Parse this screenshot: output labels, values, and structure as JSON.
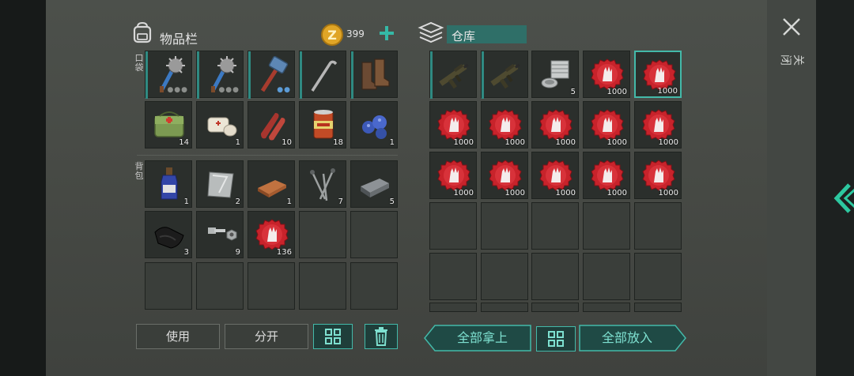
{
  "inventory": {
    "title": "物品栏",
    "coins": "399",
    "pocket_label": "口袋",
    "backpack_label": "背包",
    "pocket_items": [
      {
        "name": "spiked-club",
        "qty": ""
      },
      {
        "name": "spiked-club",
        "qty": ""
      },
      {
        "name": "sledgehammer",
        "qty": ""
      },
      {
        "name": "crowbar",
        "qty": ""
      },
      {
        "name": "boots",
        "qty": ""
      },
      {
        "name": "first-aid-bag",
        "qty": "14"
      },
      {
        "name": "bandage",
        "qty": "1"
      },
      {
        "name": "raw-meat",
        "qty": "10"
      },
      {
        "name": "canned-food",
        "qty": "18"
      },
      {
        "name": "blueberries",
        "qty": "1"
      }
    ],
    "backpack_items": [
      {
        "name": "bottle",
        "qty": "1"
      },
      {
        "name": "metal-sheet",
        "qty": "2"
      },
      {
        "name": "copper-ingot",
        "qty": "1"
      },
      {
        "name": "nails",
        "qty": "7"
      },
      {
        "name": "iron-ingot",
        "qty": "5"
      },
      {
        "name": "black-cloth",
        "qty": "3"
      },
      {
        "name": "bolt-nut",
        "qty": "9"
      },
      {
        "name": "bottle-cap",
        "qty": "136"
      }
    ],
    "use_label": "使用",
    "split_label": "分开"
  },
  "storage": {
    "title": "仓库",
    "items": [
      {
        "name": "assault-rifle",
        "qty": ""
      },
      {
        "name": "assault-rifle",
        "qty": ""
      },
      {
        "name": "engine-parts",
        "qty": "5"
      },
      {
        "name": "bottle-cap",
        "qty": "1000"
      },
      {
        "name": "bottle-cap",
        "qty": "1000"
      },
      {
        "name": "bottle-cap",
        "qty": "1000"
      },
      {
        "name": "bottle-cap",
        "qty": "1000"
      },
      {
        "name": "bottle-cap",
        "qty": "1000"
      },
      {
        "name": "bottle-cap",
        "qty": "1000"
      },
      {
        "name": "bottle-cap",
        "qty": "1000"
      },
      {
        "name": "bottle-cap",
        "qty": "1000"
      },
      {
        "name": "bottle-cap",
        "qty": "1000"
      },
      {
        "name": "bottle-cap",
        "qty": "1000"
      },
      {
        "name": "bottle-cap",
        "qty": "1000"
      },
      {
        "name": "bottle-cap",
        "qty": "1000"
      }
    ],
    "take_all_label": "全部拿上",
    "put_all_label": "全部放入"
  },
  "close_label": "关闭",
  "colors": {
    "accent": "#43b9a9",
    "coin": "#e0a526",
    "cap_red": "#c8232b"
  }
}
